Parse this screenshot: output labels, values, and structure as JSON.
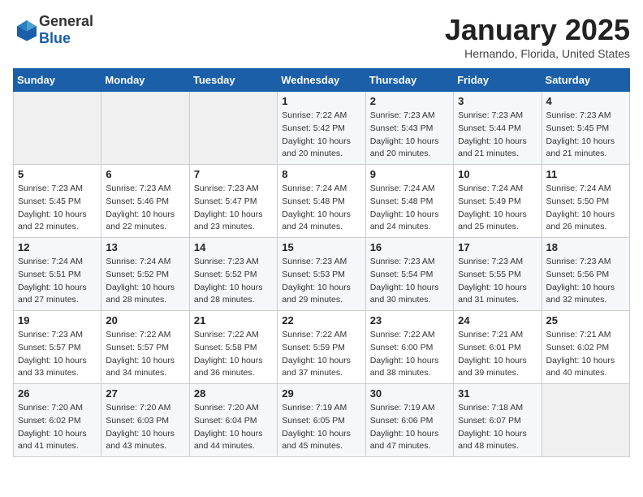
{
  "header": {
    "logo_general": "General",
    "logo_blue": "Blue",
    "month": "January 2025",
    "location": "Hernando, Florida, United States"
  },
  "weekdays": [
    "Sunday",
    "Monday",
    "Tuesday",
    "Wednesday",
    "Thursday",
    "Friday",
    "Saturday"
  ],
  "weeks": [
    [
      {
        "day": "",
        "sunrise": "",
        "sunset": "",
        "daylight": ""
      },
      {
        "day": "",
        "sunrise": "",
        "sunset": "",
        "daylight": ""
      },
      {
        "day": "",
        "sunrise": "",
        "sunset": "",
        "daylight": ""
      },
      {
        "day": "1",
        "sunrise": "Sunrise: 7:22 AM",
        "sunset": "Sunset: 5:42 PM",
        "daylight": "Daylight: 10 hours and 20 minutes."
      },
      {
        "day": "2",
        "sunrise": "Sunrise: 7:23 AM",
        "sunset": "Sunset: 5:43 PM",
        "daylight": "Daylight: 10 hours and 20 minutes."
      },
      {
        "day": "3",
        "sunrise": "Sunrise: 7:23 AM",
        "sunset": "Sunset: 5:44 PM",
        "daylight": "Daylight: 10 hours and 21 minutes."
      },
      {
        "day": "4",
        "sunrise": "Sunrise: 7:23 AM",
        "sunset": "Sunset: 5:45 PM",
        "daylight": "Daylight: 10 hours and 21 minutes."
      }
    ],
    [
      {
        "day": "5",
        "sunrise": "Sunrise: 7:23 AM",
        "sunset": "Sunset: 5:45 PM",
        "daylight": "Daylight: 10 hours and 22 minutes."
      },
      {
        "day": "6",
        "sunrise": "Sunrise: 7:23 AM",
        "sunset": "Sunset: 5:46 PM",
        "daylight": "Daylight: 10 hours and 22 minutes."
      },
      {
        "day": "7",
        "sunrise": "Sunrise: 7:23 AM",
        "sunset": "Sunset: 5:47 PM",
        "daylight": "Daylight: 10 hours and 23 minutes."
      },
      {
        "day": "8",
        "sunrise": "Sunrise: 7:24 AM",
        "sunset": "Sunset: 5:48 PM",
        "daylight": "Daylight: 10 hours and 24 minutes."
      },
      {
        "day": "9",
        "sunrise": "Sunrise: 7:24 AM",
        "sunset": "Sunset: 5:48 PM",
        "daylight": "Daylight: 10 hours and 24 minutes."
      },
      {
        "day": "10",
        "sunrise": "Sunrise: 7:24 AM",
        "sunset": "Sunset: 5:49 PM",
        "daylight": "Daylight: 10 hours and 25 minutes."
      },
      {
        "day": "11",
        "sunrise": "Sunrise: 7:24 AM",
        "sunset": "Sunset: 5:50 PM",
        "daylight": "Daylight: 10 hours and 26 minutes."
      }
    ],
    [
      {
        "day": "12",
        "sunrise": "Sunrise: 7:24 AM",
        "sunset": "Sunset: 5:51 PM",
        "daylight": "Daylight: 10 hours and 27 minutes."
      },
      {
        "day": "13",
        "sunrise": "Sunrise: 7:24 AM",
        "sunset": "Sunset: 5:52 PM",
        "daylight": "Daylight: 10 hours and 28 minutes."
      },
      {
        "day": "14",
        "sunrise": "Sunrise: 7:23 AM",
        "sunset": "Sunset: 5:52 PM",
        "daylight": "Daylight: 10 hours and 28 minutes."
      },
      {
        "day": "15",
        "sunrise": "Sunrise: 7:23 AM",
        "sunset": "Sunset: 5:53 PM",
        "daylight": "Daylight: 10 hours and 29 minutes."
      },
      {
        "day": "16",
        "sunrise": "Sunrise: 7:23 AM",
        "sunset": "Sunset: 5:54 PM",
        "daylight": "Daylight: 10 hours and 30 minutes."
      },
      {
        "day": "17",
        "sunrise": "Sunrise: 7:23 AM",
        "sunset": "Sunset: 5:55 PM",
        "daylight": "Daylight: 10 hours and 31 minutes."
      },
      {
        "day": "18",
        "sunrise": "Sunrise: 7:23 AM",
        "sunset": "Sunset: 5:56 PM",
        "daylight": "Daylight: 10 hours and 32 minutes."
      }
    ],
    [
      {
        "day": "19",
        "sunrise": "Sunrise: 7:23 AM",
        "sunset": "Sunset: 5:57 PM",
        "daylight": "Daylight: 10 hours and 33 minutes."
      },
      {
        "day": "20",
        "sunrise": "Sunrise: 7:22 AM",
        "sunset": "Sunset: 5:57 PM",
        "daylight": "Daylight: 10 hours and 34 minutes."
      },
      {
        "day": "21",
        "sunrise": "Sunrise: 7:22 AM",
        "sunset": "Sunset: 5:58 PM",
        "daylight": "Daylight: 10 hours and 36 minutes."
      },
      {
        "day": "22",
        "sunrise": "Sunrise: 7:22 AM",
        "sunset": "Sunset: 5:59 PM",
        "daylight": "Daylight: 10 hours and 37 minutes."
      },
      {
        "day": "23",
        "sunrise": "Sunrise: 7:22 AM",
        "sunset": "Sunset: 6:00 PM",
        "daylight": "Daylight: 10 hours and 38 minutes."
      },
      {
        "day": "24",
        "sunrise": "Sunrise: 7:21 AM",
        "sunset": "Sunset: 6:01 PM",
        "daylight": "Daylight: 10 hours and 39 minutes."
      },
      {
        "day": "25",
        "sunrise": "Sunrise: 7:21 AM",
        "sunset": "Sunset: 6:02 PM",
        "daylight": "Daylight: 10 hours and 40 minutes."
      }
    ],
    [
      {
        "day": "26",
        "sunrise": "Sunrise: 7:20 AM",
        "sunset": "Sunset: 6:02 PM",
        "daylight": "Daylight: 10 hours and 41 minutes."
      },
      {
        "day": "27",
        "sunrise": "Sunrise: 7:20 AM",
        "sunset": "Sunset: 6:03 PM",
        "daylight": "Daylight: 10 hours and 43 minutes."
      },
      {
        "day": "28",
        "sunrise": "Sunrise: 7:20 AM",
        "sunset": "Sunset: 6:04 PM",
        "daylight": "Daylight: 10 hours and 44 minutes."
      },
      {
        "day": "29",
        "sunrise": "Sunrise: 7:19 AM",
        "sunset": "Sunset: 6:05 PM",
        "daylight": "Daylight: 10 hours and 45 minutes."
      },
      {
        "day": "30",
        "sunrise": "Sunrise: 7:19 AM",
        "sunset": "Sunset: 6:06 PM",
        "daylight": "Daylight: 10 hours and 47 minutes."
      },
      {
        "day": "31",
        "sunrise": "Sunrise: 7:18 AM",
        "sunset": "Sunset: 6:07 PM",
        "daylight": "Daylight: 10 hours and 48 minutes."
      },
      {
        "day": "",
        "sunrise": "",
        "sunset": "",
        "daylight": ""
      }
    ]
  ]
}
